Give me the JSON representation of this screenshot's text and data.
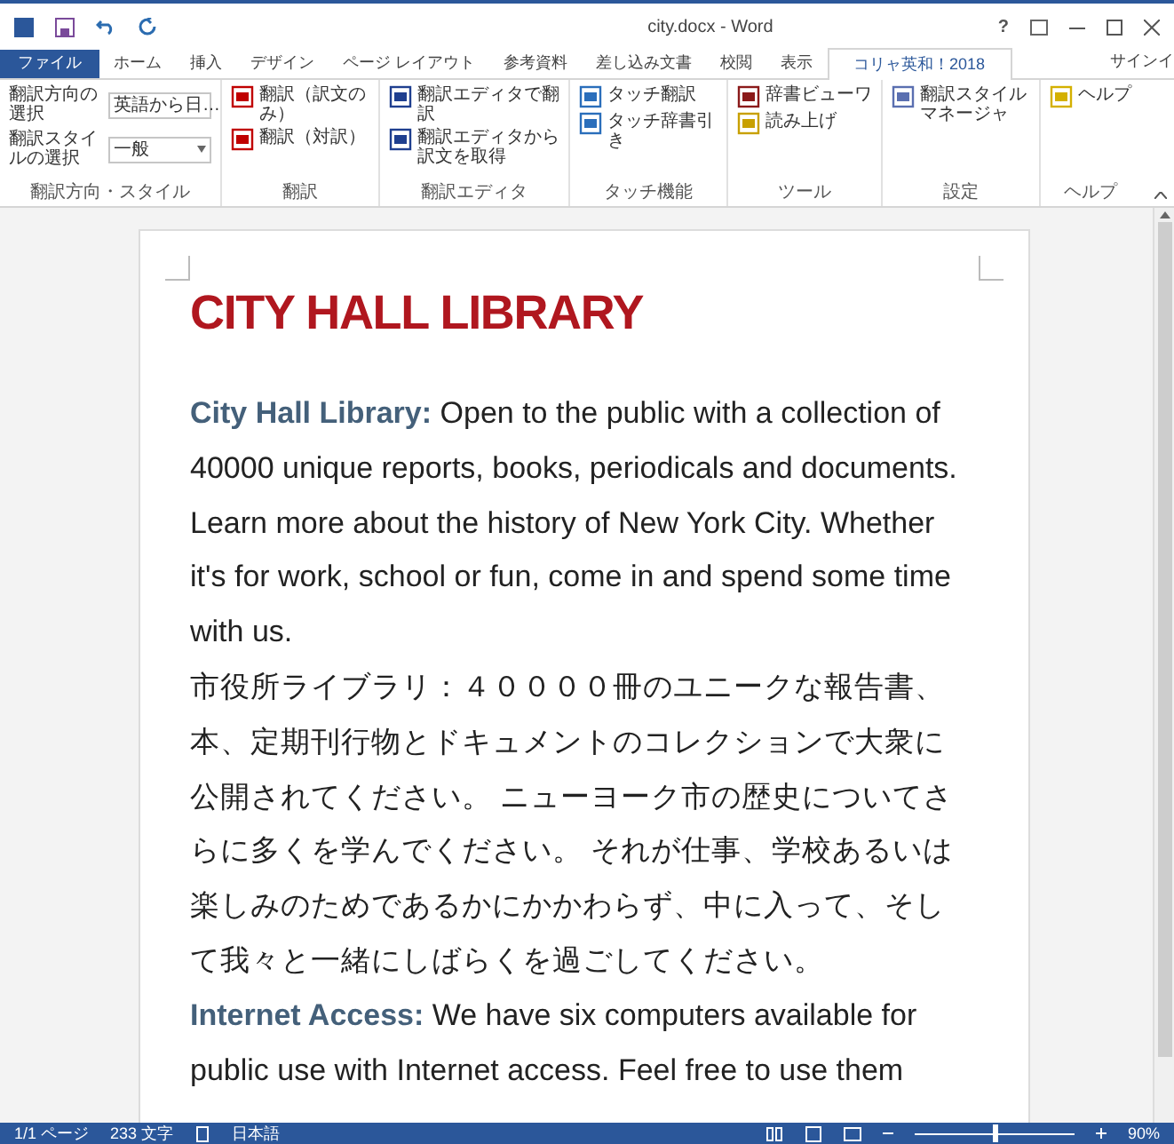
{
  "window": {
    "title": "city.docx - Word",
    "help": "?"
  },
  "tabs": [
    {
      "label": "ファイル",
      "kind": "file",
      "selected": false
    },
    {
      "label": "ホーム",
      "kind": "tab",
      "selected": false
    },
    {
      "label": "挿入",
      "kind": "tab",
      "selected": false
    },
    {
      "label": "デザイン",
      "kind": "tab",
      "selected": false
    },
    {
      "label": "ページ レイアウト",
      "kind": "tab",
      "selected": false
    },
    {
      "label": "参考資料",
      "kind": "tab",
      "selected": false
    },
    {
      "label": "差し込み文書",
      "kind": "tab",
      "selected": false
    },
    {
      "label": "校閲",
      "kind": "tab",
      "selected": false
    },
    {
      "label": "表示",
      "kind": "tab",
      "selected": false
    },
    {
      "label": "コリャ英和！2018",
      "kind": "tab",
      "selected": true
    }
  ],
  "signin": "サインイ",
  "ribbon": {
    "groups": [
      {
        "label": "翻訳方向・スタイル",
        "kind": "selects",
        "items": [
          {
            "label": "翻訳方向の選択",
            "value": "英語から日…"
          },
          {
            "label": "翻訳スタイルの選択",
            "value": "一般"
          }
        ]
      },
      {
        "label": "翻訳",
        "kind": "buttons",
        "items": [
          {
            "label": "翻訳（訳文のみ）"
          },
          {
            "label": "翻訳（対訳）"
          }
        ]
      },
      {
        "label": "翻訳エディタ",
        "kind": "buttons",
        "items": [
          {
            "label": "翻訳エディタで翻訳"
          },
          {
            "label": "翻訳エディタから訳文を取得"
          }
        ]
      },
      {
        "label": "タッチ機能",
        "kind": "buttons",
        "items": [
          {
            "label": "タッチ翻訳"
          },
          {
            "label": "タッチ辞書引き"
          }
        ]
      },
      {
        "label": "ツール",
        "kind": "buttons",
        "items": [
          {
            "label": "辞書ビューワ"
          },
          {
            "label": "読み上げ"
          }
        ]
      },
      {
        "label": "設定",
        "kind": "buttons",
        "items": [
          {
            "label": "翻訳スタイルマネージャ"
          }
        ]
      },
      {
        "label": "ヘルプ",
        "kind": "buttons",
        "items": [
          {
            "label": "ヘルプ"
          }
        ]
      }
    ]
  },
  "document": {
    "title": "CITY HALL LIBRARY",
    "paragraphs": [
      {
        "lead": "City Hall Library:",
        "text": " Open to the public with a collection of 40000 unique reports, books, periodicals and documents. Learn more about the history of New York City. Whether it's for work, school or fun, come in and spend some time with us."
      },
      {
        "text": "市役所ライブラリ：４００００冊のユニークな報告書、本、定期刊行物とドキュメントのコレクションで大衆に公開されてください。 ニューヨーク市の歴史についてさらに多くを学んでください。 それが仕事、学校あるいは楽しみのためであるかにかかわらず、中に入って、そして我々と一緒にしばらくを過ごしてください。"
      },
      {
        "lead": "Internet Access:",
        "text": " We have six computers available for public use with Internet access. Feel free to use them"
      }
    ]
  },
  "status_bar": {
    "page": "1/1 ページ",
    "words": "233 文字",
    "language": "日本語",
    "zoom": "90%",
    "zoom_slider": {
      "level": 0.5
    }
  }
}
